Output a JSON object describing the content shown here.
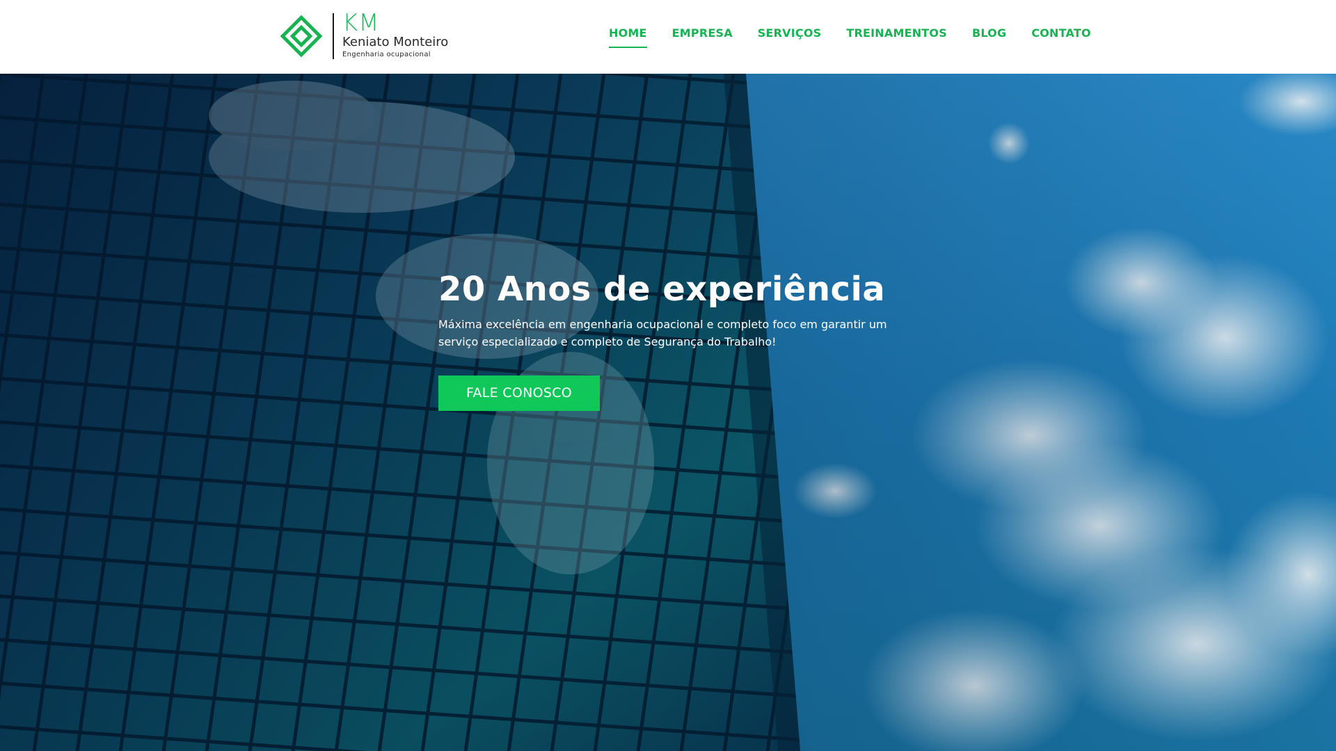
{
  "logo": {
    "initials": "KM",
    "name": "Keniato Monteiro",
    "tagline": "Engenharia ocupacional",
    "icon": "diamond-logo-icon"
  },
  "nav": {
    "items": [
      {
        "label": "HOME",
        "active": true
      },
      {
        "label": "EMPRESA",
        "active": false
      },
      {
        "label": "SERVIÇOS",
        "active": false
      },
      {
        "label": "TREINAMENTOS",
        "active": false
      },
      {
        "label": "BLOG",
        "active": false
      },
      {
        "label": "CONTATO",
        "active": false
      }
    ]
  },
  "hero": {
    "title": "20 Anos de experiência",
    "description": "Máxima excelência em engenharia ocupacional e completo foco em garantir um serviço especializado e completo de Segurança do Trabalho!",
    "cta_label": "FALE CONOSCO"
  },
  "colors": {
    "brand_green": "#17b352",
    "cta_green": "#10c85a",
    "sky_blue": "#1a6fa8"
  }
}
